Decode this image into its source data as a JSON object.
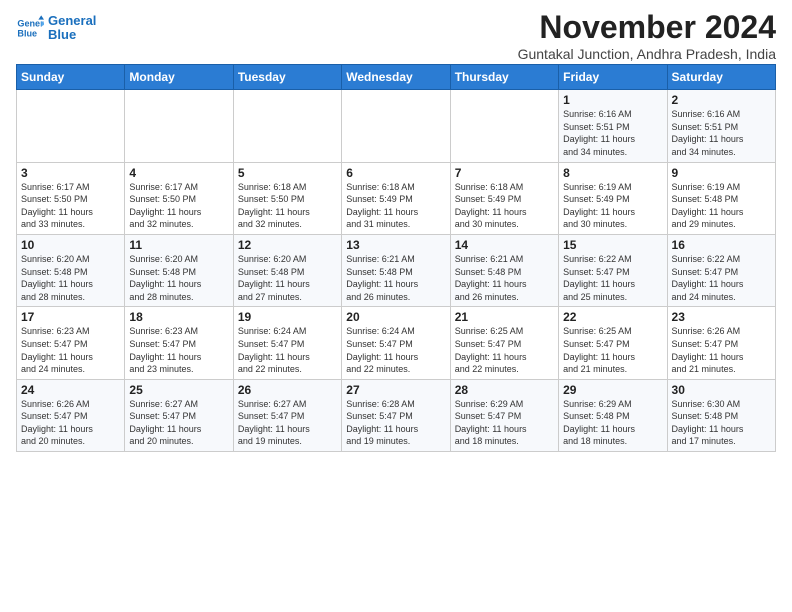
{
  "logo": {
    "line1": "General",
    "line2": "Blue"
  },
  "title": "November 2024",
  "location": "Guntakal Junction, Andhra Pradesh, India",
  "weekdays": [
    "Sunday",
    "Monday",
    "Tuesday",
    "Wednesday",
    "Thursday",
    "Friday",
    "Saturday"
  ],
  "weeks": [
    [
      {
        "day": "",
        "info": ""
      },
      {
        "day": "",
        "info": ""
      },
      {
        "day": "",
        "info": ""
      },
      {
        "day": "",
        "info": ""
      },
      {
        "day": "",
        "info": ""
      },
      {
        "day": "1",
        "info": "Sunrise: 6:16 AM\nSunset: 5:51 PM\nDaylight: 11 hours\nand 34 minutes."
      },
      {
        "day": "2",
        "info": "Sunrise: 6:16 AM\nSunset: 5:51 PM\nDaylight: 11 hours\nand 34 minutes."
      }
    ],
    [
      {
        "day": "3",
        "info": "Sunrise: 6:17 AM\nSunset: 5:50 PM\nDaylight: 11 hours\nand 33 minutes."
      },
      {
        "day": "4",
        "info": "Sunrise: 6:17 AM\nSunset: 5:50 PM\nDaylight: 11 hours\nand 32 minutes."
      },
      {
        "day": "5",
        "info": "Sunrise: 6:18 AM\nSunset: 5:50 PM\nDaylight: 11 hours\nand 32 minutes."
      },
      {
        "day": "6",
        "info": "Sunrise: 6:18 AM\nSunset: 5:49 PM\nDaylight: 11 hours\nand 31 minutes."
      },
      {
        "day": "7",
        "info": "Sunrise: 6:18 AM\nSunset: 5:49 PM\nDaylight: 11 hours\nand 30 minutes."
      },
      {
        "day": "8",
        "info": "Sunrise: 6:19 AM\nSunset: 5:49 PM\nDaylight: 11 hours\nand 30 minutes."
      },
      {
        "day": "9",
        "info": "Sunrise: 6:19 AM\nSunset: 5:48 PM\nDaylight: 11 hours\nand 29 minutes."
      }
    ],
    [
      {
        "day": "10",
        "info": "Sunrise: 6:20 AM\nSunset: 5:48 PM\nDaylight: 11 hours\nand 28 minutes."
      },
      {
        "day": "11",
        "info": "Sunrise: 6:20 AM\nSunset: 5:48 PM\nDaylight: 11 hours\nand 28 minutes."
      },
      {
        "day": "12",
        "info": "Sunrise: 6:20 AM\nSunset: 5:48 PM\nDaylight: 11 hours\nand 27 minutes."
      },
      {
        "day": "13",
        "info": "Sunrise: 6:21 AM\nSunset: 5:48 PM\nDaylight: 11 hours\nand 26 minutes."
      },
      {
        "day": "14",
        "info": "Sunrise: 6:21 AM\nSunset: 5:48 PM\nDaylight: 11 hours\nand 26 minutes."
      },
      {
        "day": "15",
        "info": "Sunrise: 6:22 AM\nSunset: 5:47 PM\nDaylight: 11 hours\nand 25 minutes."
      },
      {
        "day": "16",
        "info": "Sunrise: 6:22 AM\nSunset: 5:47 PM\nDaylight: 11 hours\nand 24 minutes."
      }
    ],
    [
      {
        "day": "17",
        "info": "Sunrise: 6:23 AM\nSunset: 5:47 PM\nDaylight: 11 hours\nand 24 minutes."
      },
      {
        "day": "18",
        "info": "Sunrise: 6:23 AM\nSunset: 5:47 PM\nDaylight: 11 hours\nand 23 minutes."
      },
      {
        "day": "19",
        "info": "Sunrise: 6:24 AM\nSunset: 5:47 PM\nDaylight: 11 hours\nand 22 minutes."
      },
      {
        "day": "20",
        "info": "Sunrise: 6:24 AM\nSunset: 5:47 PM\nDaylight: 11 hours\nand 22 minutes."
      },
      {
        "day": "21",
        "info": "Sunrise: 6:25 AM\nSunset: 5:47 PM\nDaylight: 11 hours\nand 22 minutes."
      },
      {
        "day": "22",
        "info": "Sunrise: 6:25 AM\nSunset: 5:47 PM\nDaylight: 11 hours\nand 21 minutes."
      },
      {
        "day": "23",
        "info": "Sunrise: 6:26 AM\nSunset: 5:47 PM\nDaylight: 11 hours\nand 21 minutes."
      }
    ],
    [
      {
        "day": "24",
        "info": "Sunrise: 6:26 AM\nSunset: 5:47 PM\nDaylight: 11 hours\nand 20 minutes."
      },
      {
        "day": "25",
        "info": "Sunrise: 6:27 AM\nSunset: 5:47 PM\nDaylight: 11 hours\nand 20 minutes."
      },
      {
        "day": "26",
        "info": "Sunrise: 6:27 AM\nSunset: 5:47 PM\nDaylight: 11 hours\nand 19 minutes."
      },
      {
        "day": "27",
        "info": "Sunrise: 6:28 AM\nSunset: 5:47 PM\nDaylight: 11 hours\nand 19 minutes."
      },
      {
        "day": "28",
        "info": "Sunrise: 6:29 AM\nSunset: 5:47 PM\nDaylight: 11 hours\nand 18 minutes."
      },
      {
        "day": "29",
        "info": "Sunrise: 6:29 AM\nSunset: 5:48 PM\nDaylight: 11 hours\nand 18 minutes."
      },
      {
        "day": "30",
        "info": "Sunrise: 6:30 AM\nSunset: 5:48 PM\nDaylight: 11 hours\nand 17 minutes."
      }
    ]
  ]
}
